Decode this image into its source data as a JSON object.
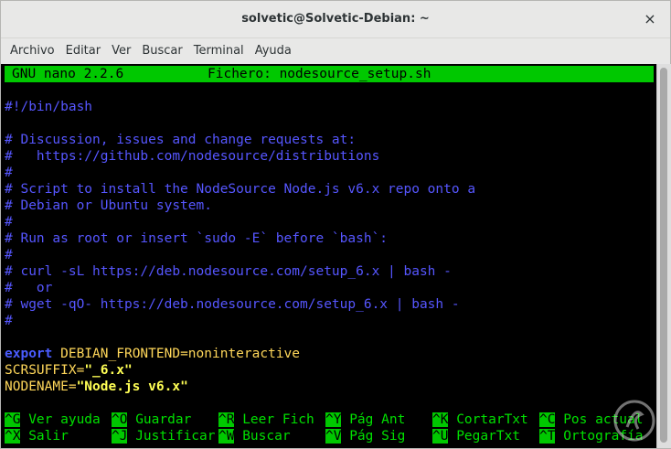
{
  "window": {
    "title": "solvetic@Solvetic-Debian: ~",
    "close_glyph": "×"
  },
  "menubar": {
    "items": [
      "Archivo",
      "Editar",
      "Ver",
      "Buscar",
      "Terminal",
      "Ayuda"
    ]
  },
  "nano": {
    "version": "GNU nano 2.2.6",
    "file_label": "Fichero: nodesource_setup.sh",
    "lines": [
      "#!/bin/bash",
      "",
      "# Discussion, issues and change requests at:",
      "#   https://github.com/nodesource/distributions",
      "#",
      "# Script to install the NodeSource Node.js v6.x repo onto a",
      "# Debian or Ubuntu system.",
      "#",
      "# Run as root or insert `sudo -E` before `bash`:",
      "#",
      "# curl -sL https://deb.nodesource.com/setup_6.x | bash -",
      "#   or",
      "# wget -qO- https://deb.nodesource.com/setup_6.x | bash -",
      "#",
      ""
    ],
    "code": {
      "export_kw": "export",
      "export_rest": " DEBIAN_FRONTEND=noninteractive",
      "scrsuffix_name": "SCRSUFFIX=",
      "scrsuffix_value": "\"_6.x\"",
      "nodename_name": "NODENAME=",
      "nodename_value": "\"Node.js v6.x\""
    },
    "shortcuts_row1": [
      {
        "key": "^G",
        "label": " Ver ayuda"
      },
      {
        "key": "^O",
        "label": " Guardar"
      },
      {
        "key": "^R",
        "label": " Leer Fich"
      },
      {
        "key": "^Y",
        "label": " Pág Ant"
      },
      {
        "key": "^K",
        "label": " CortarTxt"
      },
      {
        "key": "^C",
        "label": " Pos actual"
      }
    ],
    "shortcuts_row2": [
      {
        "key": "^X",
        "label": " Salir"
      },
      {
        "key": "^J",
        "label": " Justificar"
      },
      {
        "key": "^W",
        "label": " Buscar"
      },
      {
        "key": "^V",
        "label": " Pág Sig"
      },
      {
        "key": "^U",
        "label": " PegarTxt"
      },
      {
        "key": "^T",
        "label": " Ortografía"
      }
    ]
  },
  "colors": {
    "terminal_bg": "#000000",
    "nano_bar": "#00c800",
    "comment": "#5656ff",
    "string": "#ffff55"
  }
}
